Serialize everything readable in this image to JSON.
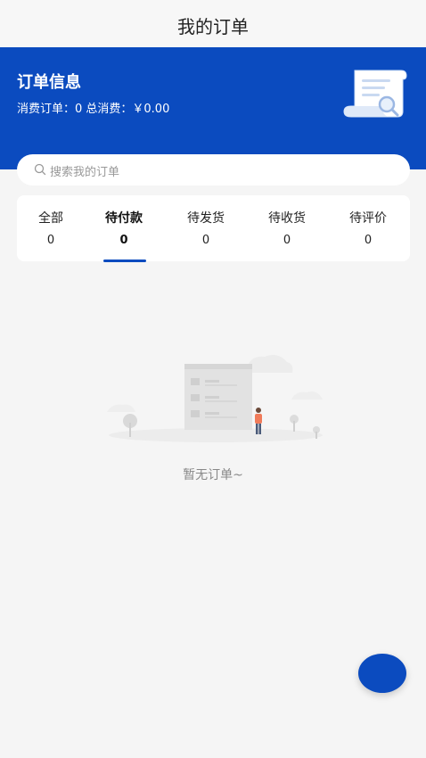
{
  "header": {
    "title": "我的订单"
  },
  "banner": {
    "title": "订单信息",
    "stats": "消费订单：0 总消费：￥0.00",
    "illustration_icon": "scroll-search-icon",
    "color": "#0b4bbf"
  },
  "search": {
    "placeholder": "搜索我的订单",
    "icon": "search-icon"
  },
  "tabs": [
    {
      "label": "全部",
      "count": "0"
    },
    {
      "label": "待付款",
      "count": "0",
      "active": true
    },
    {
      "label": "待发货",
      "count": "0"
    },
    {
      "label": "待收货",
      "count": "0"
    },
    {
      "label": "待评价",
      "count": "0"
    }
  ],
  "empty_state": {
    "text": "暂无订单~",
    "illustration": "empty-orders-illustration"
  },
  "fab": {
    "icon": "floating-action-button",
    "color": "#0b4bbf"
  }
}
